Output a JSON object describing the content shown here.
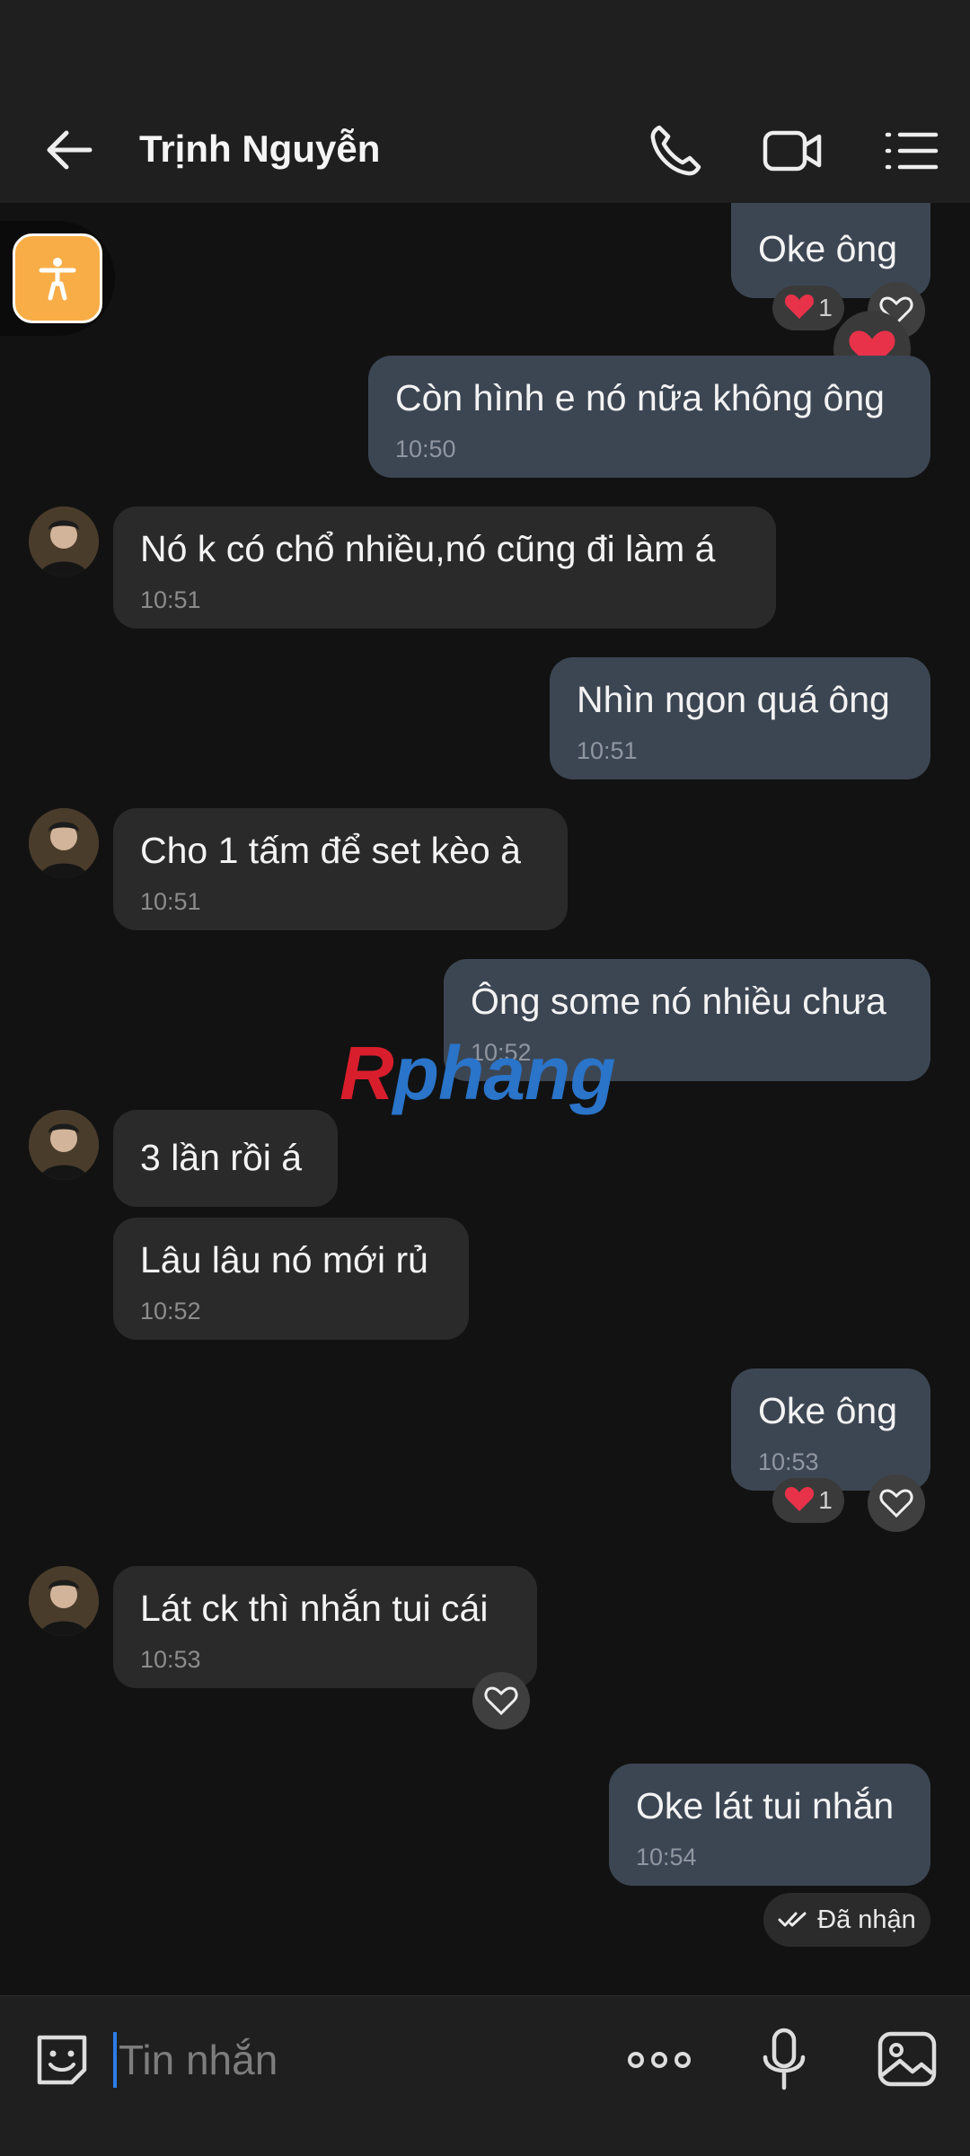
{
  "header": {
    "title": "Trịnh Nguyễn",
    "icons": [
      "back-arrow-icon",
      "phone-icon",
      "video-camera-icon",
      "menu-list-icon"
    ]
  },
  "messages": [
    {
      "side": "out",
      "text": "Oke ông",
      "time": "",
      "reaction": {
        "emoji": "❤️",
        "count": "1"
      }
    },
    {
      "side": "out",
      "text": "Còn hình e nó nữa không ông",
      "time": "10:50"
    },
    {
      "side": "in",
      "text": "Nó k có chổ nhiều,nó cũng đi làm á",
      "time": "10:51"
    },
    {
      "side": "out",
      "text": "Nhìn ngon quá ông",
      "time": "10:51"
    },
    {
      "side": "in",
      "text": "Cho 1 tấm để set kèo à",
      "time": "10:51"
    },
    {
      "side": "out",
      "text": "Ông some nó nhiều chưa",
      "time": "10:52"
    },
    {
      "side": "in",
      "text": "3 lần rồi á",
      "time": ""
    },
    {
      "side": "in",
      "text": "Lâu lâu nó mới rủ",
      "time": "10:52"
    },
    {
      "side": "out",
      "text": "Oke ông",
      "time": "10:53",
      "reaction": {
        "emoji": "❤️",
        "count": "1"
      }
    },
    {
      "side": "in",
      "text": "Lát ck thì nhắn tui cái",
      "time": "10:53"
    },
    {
      "side": "out",
      "text": "Oke lát tui nhắn",
      "time": "10:54"
    }
  ],
  "status": {
    "received": "Đã nhận"
  },
  "watermark": {
    "part1": "R",
    "part2": "phang"
  },
  "composer": {
    "placeholder": "Tin nhắn"
  },
  "colors": {
    "accent": "#2b7de9",
    "bubble_out": "#3c4653",
    "bubble_in": "#2a2a2b",
    "accessibility": "#f8ad47"
  }
}
